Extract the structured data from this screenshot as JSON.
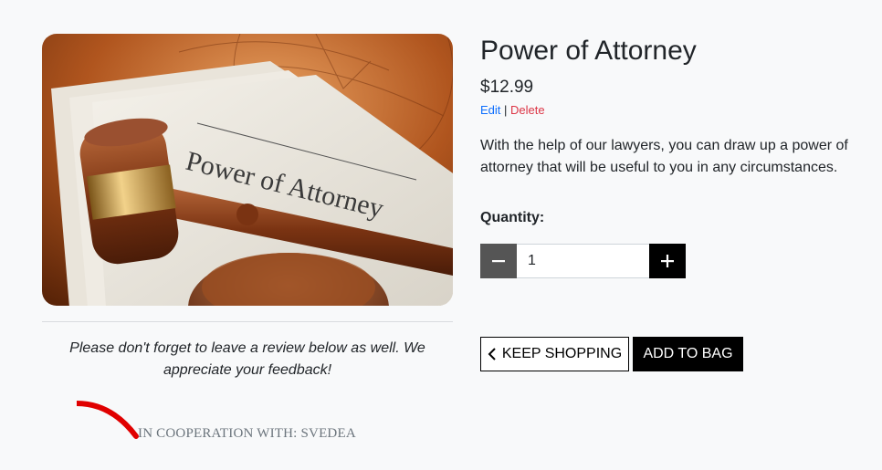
{
  "product": {
    "image_alt": "Power of Attorney",
    "image_caption": "Power of Attorney",
    "title": "Power of Attorney",
    "price": "$12.99",
    "description": "With the help of our lawyers, you can draw up a power of attorney that will be useful to you in any circumstances."
  },
  "admin": {
    "edit_label": "Edit",
    "separator": "|",
    "delete_label": "Delete"
  },
  "quantity": {
    "label": "Quantity:",
    "value": "1",
    "decrement_icon": "minus-icon",
    "increment_icon": "plus-icon"
  },
  "actions": {
    "keep_shopping_label": "KEEP SHOPPING",
    "keep_shopping_icon": "chevron-left-icon",
    "add_to_bag_label": "ADD TO BAG"
  },
  "review_note": "Please don't forget to leave a review below as well. We appreciate your feedback!",
  "cooperation": "IN COOPERATION WITH: SVEDEA",
  "colors": {
    "edit_link": "#0d6efd",
    "delete_link": "#dc3545",
    "accent_arc": "#e00000",
    "minus_button": "#555555",
    "plus_button": "#000000"
  }
}
